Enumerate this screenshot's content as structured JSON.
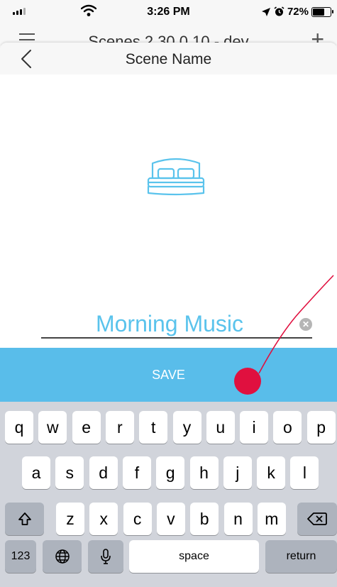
{
  "status_bar": {
    "time": "3:26 PM",
    "battery": "72%",
    "battery_level": 0.72
  },
  "background_page": {
    "title": "Scenes 2.30.0.10 - dev"
  },
  "modal": {
    "title": "Scene Name"
  },
  "scene_icon": "bed-icon",
  "name_field": {
    "value": "Morning Music"
  },
  "save_label": "SAVE",
  "keyboard": {
    "row1": [
      "q",
      "w",
      "e",
      "r",
      "t",
      "y",
      "u",
      "i",
      "o",
      "p"
    ],
    "row2": [
      "a",
      "s",
      "d",
      "f",
      "g",
      "h",
      "j",
      "k",
      "l"
    ],
    "row3": [
      "z",
      "x",
      "c",
      "v",
      "b",
      "n",
      "m"
    ],
    "numbers_label": "123",
    "space_label": "space",
    "return_label": "return"
  },
  "colors": {
    "accent": "#5ac3ec",
    "save_bar": "#59bdea",
    "annotation": "#e0103f"
  }
}
